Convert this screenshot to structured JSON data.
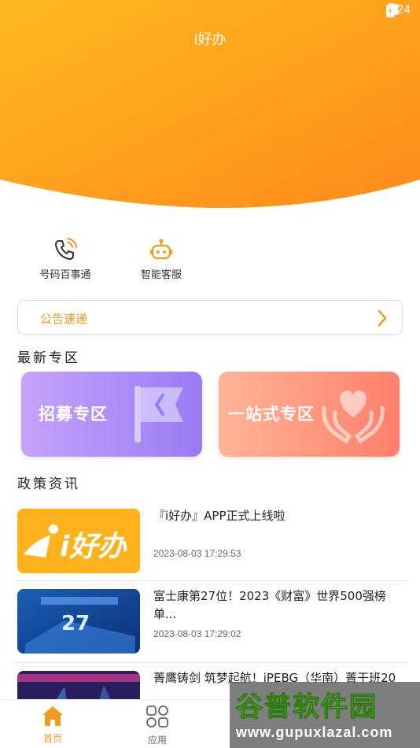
{
  "status_bar": {
    "time": "6:24"
  },
  "header": {
    "title": "i好办"
  },
  "quick_actions": [
    {
      "label": "号码百事通",
      "icon": "phone-icon"
    },
    {
      "label": "智能客服",
      "icon": "robot-icon"
    }
  ],
  "notice": {
    "label": "公告速递"
  },
  "zones": {
    "title": "最新专区",
    "items": [
      {
        "label": "招募专区",
        "icon": "flag-icon"
      },
      {
        "label": "一站式专区",
        "icon": "heart-hands-icon"
      }
    ]
  },
  "policy": {
    "title": "政策资讯",
    "items": [
      {
        "title": "『i好办』APP正式上线啦",
        "date": "2023-08-03 17:29:53",
        "thumb_text": "i好办"
      },
      {
        "title": "富士康第27位！2023《财富》世界500强榜单...",
        "date": "2023-08-03 17:29:02",
        "thumb_text": "27"
      },
      {
        "title": "菁鹰铸剑 筑梦起航！iPEBG（华南）菁干班20",
        "date": "",
        "thumb_text": ""
      }
    ]
  },
  "bottom_nav": [
    {
      "label": "首页",
      "icon": "home-icon",
      "active": true
    },
    {
      "label": "应用",
      "icon": "apps-icon",
      "active": false
    }
  ],
  "watermark": {
    "name": "谷普软件园",
    "url": "www.gupuxlazal.com"
  },
  "colors": {
    "accent": "#f39b1c",
    "hero_start": "#ffb320",
    "hero_end": "#ff8a1c"
  }
}
